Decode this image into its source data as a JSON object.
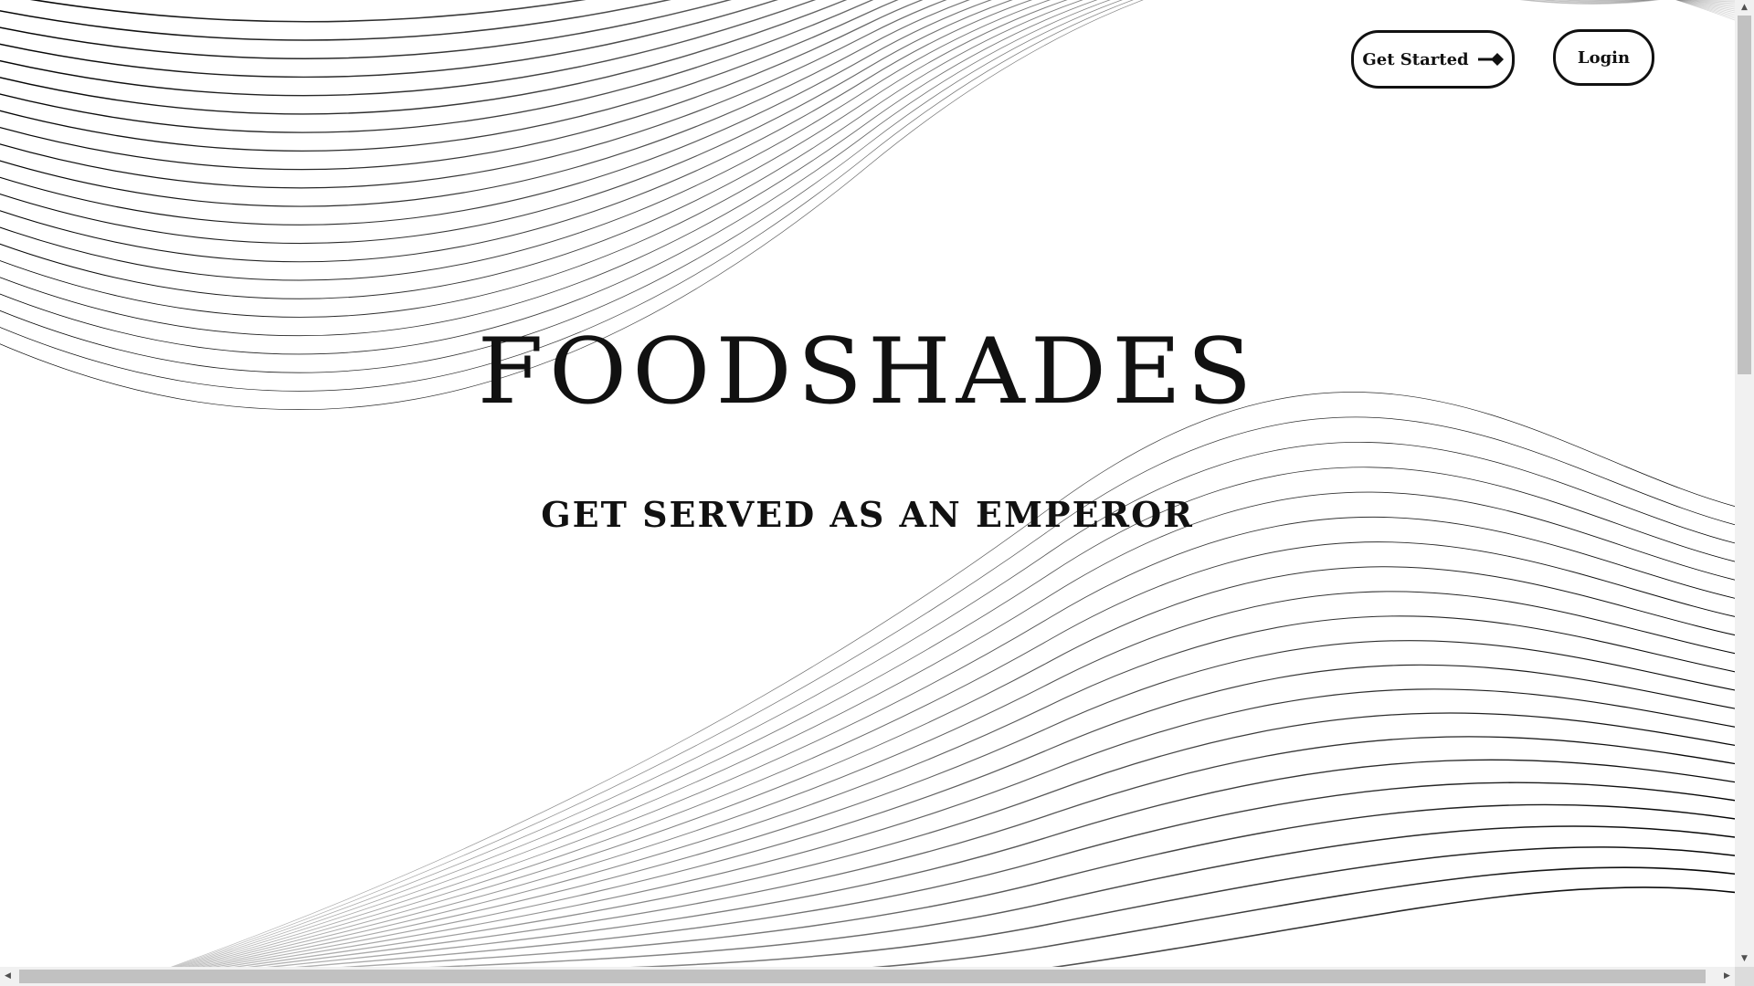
{
  "header": {
    "get_started_label": "Get Started",
    "get_started_icon": "arrow-right-icon",
    "login_label": "Login"
  },
  "hero": {
    "brand": "FOODSHADES",
    "tagline": "GET SERVED AS AN EMPEROR"
  },
  "colors": {
    "ink": "#111111",
    "background": "#ffffff"
  }
}
